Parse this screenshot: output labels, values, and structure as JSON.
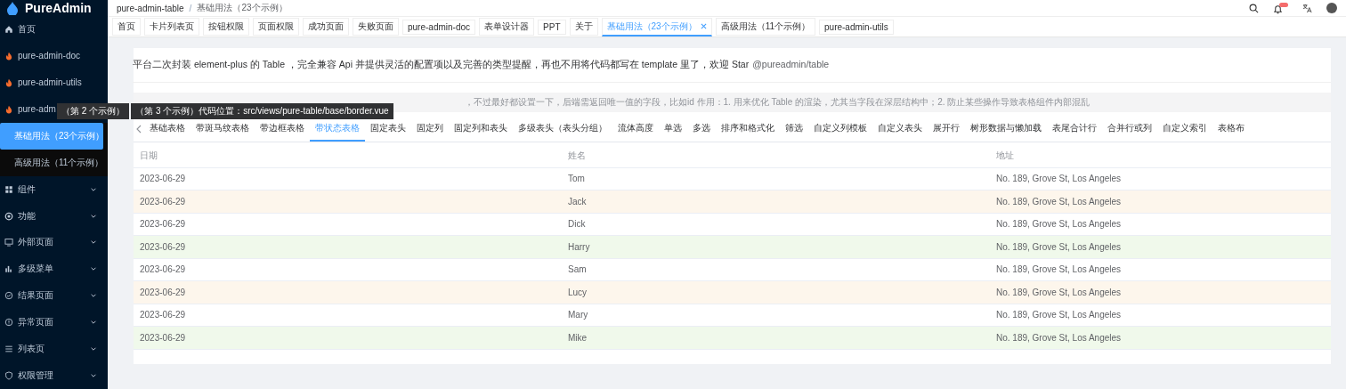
{
  "sidebar": {
    "logo": "PureAdmin",
    "items": [
      {
        "kind": "home",
        "label": "首页",
        "expandable": false
      },
      {
        "kind": "fire",
        "label": "pure-admin-doc",
        "expandable": false
      },
      {
        "kind": "fire",
        "label": "pure-admin-utils",
        "expandable": false
      },
      {
        "kind": "fire",
        "label": "pure-adm",
        "expandable": false,
        "children": [
          {
            "label": "基础用法（23个示例）",
            "selected": true
          },
          {
            "label": "高级用法（11个示例）",
            "selected": false
          }
        ]
      },
      {
        "kind": "grid",
        "label": "组件",
        "expandable": true
      },
      {
        "kind": "eye",
        "label": "功能",
        "expandable": true
      },
      {
        "kind": "monitor",
        "label": "外部页面",
        "expandable": true
      },
      {
        "kind": "bars",
        "label": "多级菜单",
        "expandable": true
      },
      {
        "kind": "check",
        "label": "结果页面",
        "expandable": true
      },
      {
        "kind": "info",
        "label": "异常页面",
        "expandable": true
      },
      {
        "kind": "list",
        "label": "列表页",
        "expandable": true
      },
      {
        "kind": "shield",
        "label": "权限管理",
        "expandable": true
      }
    ]
  },
  "breadcrumb": [
    "pure-admin-table",
    "基础用法（23个示例）"
  ],
  "breadcrumb_separator": "/",
  "tags": [
    {
      "label": "首页",
      "selected": false
    },
    {
      "label": "卡片列表页",
      "selected": false
    },
    {
      "label": "按钮权限",
      "selected": false
    },
    {
      "label": "页面权限",
      "selected": false
    },
    {
      "label": "成功页面",
      "selected": false
    },
    {
      "label": "失败页面",
      "selected": false
    },
    {
      "label": "pure-admin-doc",
      "selected": false
    },
    {
      "label": "表单设计器",
      "selected": false
    },
    {
      "label": "PPT",
      "selected": false
    },
    {
      "label": "关于",
      "selected": false
    },
    {
      "label": "基础用法（23个示例）",
      "selected": true
    },
    {
      "label": "高级用法（11个示例）",
      "selected": false
    },
    {
      "label": "pure-admin-utils",
      "selected": false
    }
  ],
  "description": {
    "text": "平台二次封装 element-plus 的 Table ，完全兼容 Api 并提供灵活的配置项以及完善的类型提醒，再也不用将代码都写在 template 里了，欢迎 Star",
    "link": "@pureadmin/table"
  },
  "alert": "，不过最好都设置一下，后端需返回唯一值的字段，比如id 作用：1. 用来优化 Table 的渲染，尤其当字段在深层结构中；2. 防止某些操作导致表格组件内部混乱",
  "tooltips": [
    "（第 2 个示例）",
    "（第 3 个示例）代码位置：src/views/pure-table/base/border.vue"
  ],
  "tabs": [
    {
      "label": "基础表格",
      "selected": false
    },
    {
      "label": "带斑马纹表格",
      "selected": false
    },
    {
      "label": "带边框表格",
      "selected": false
    },
    {
      "label": "带状态表格",
      "selected": true
    },
    {
      "label": "固定表头",
      "selected": false
    },
    {
      "label": "固定列",
      "selected": false
    },
    {
      "label": "固定列和表头",
      "selected": false
    },
    {
      "label": "多级表头（表头分组）",
      "selected": false
    },
    {
      "label": "流体高度",
      "selected": false
    },
    {
      "label": "单选",
      "selected": false
    },
    {
      "label": "多选",
      "selected": false
    },
    {
      "label": "排序和格式化",
      "selected": false
    },
    {
      "label": "筛选",
      "selected": false
    },
    {
      "label": "自定义列模板",
      "selected": false
    },
    {
      "label": "自定义表头",
      "selected": false
    },
    {
      "label": "展开行",
      "selected": false
    },
    {
      "label": "树形数据与懒加载",
      "selected": false
    },
    {
      "label": "表尾合计行",
      "selected": false
    },
    {
      "label": "合并行或列",
      "selected": false
    },
    {
      "label": "自定义索引",
      "selected": false
    },
    {
      "label": "表格布",
      "selected": false
    }
  ],
  "table": {
    "columns": [
      "日期",
      "姓名",
      "地址"
    ],
    "rows": [
      {
        "kind": "normal",
        "cells": [
          "2023-06-29",
          "Tom",
          "No. 189, Grove St, Los Angeles"
        ]
      },
      {
        "kind": "warning",
        "cells": [
          "2023-06-29",
          "Jack",
          "No. 189, Grove St, Los Angeles"
        ]
      },
      {
        "kind": "normal",
        "cells": [
          "2023-06-29",
          "Dick",
          "No. 189, Grove St, Los Angeles"
        ]
      },
      {
        "kind": "success",
        "cells": [
          "2023-06-29",
          "Harry",
          "No. 189, Grove St, Los Angeles"
        ]
      },
      {
        "kind": "normal",
        "cells": [
          "2023-06-29",
          "Sam",
          "No. 189, Grove St, Los Angeles"
        ]
      },
      {
        "kind": "warning",
        "cells": [
          "2023-06-29",
          "Lucy",
          "No. 189, Grove St, Los Angeles"
        ]
      },
      {
        "kind": "normal",
        "cells": [
          "2023-06-29",
          "Mary",
          "No. 189, Grove St, Los Angeles"
        ]
      },
      {
        "kind": "success",
        "cells": [
          "2023-06-29",
          "Mike",
          "No. 189, Grove St, Los Angeles"
        ]
      }
    ]
  }
}
